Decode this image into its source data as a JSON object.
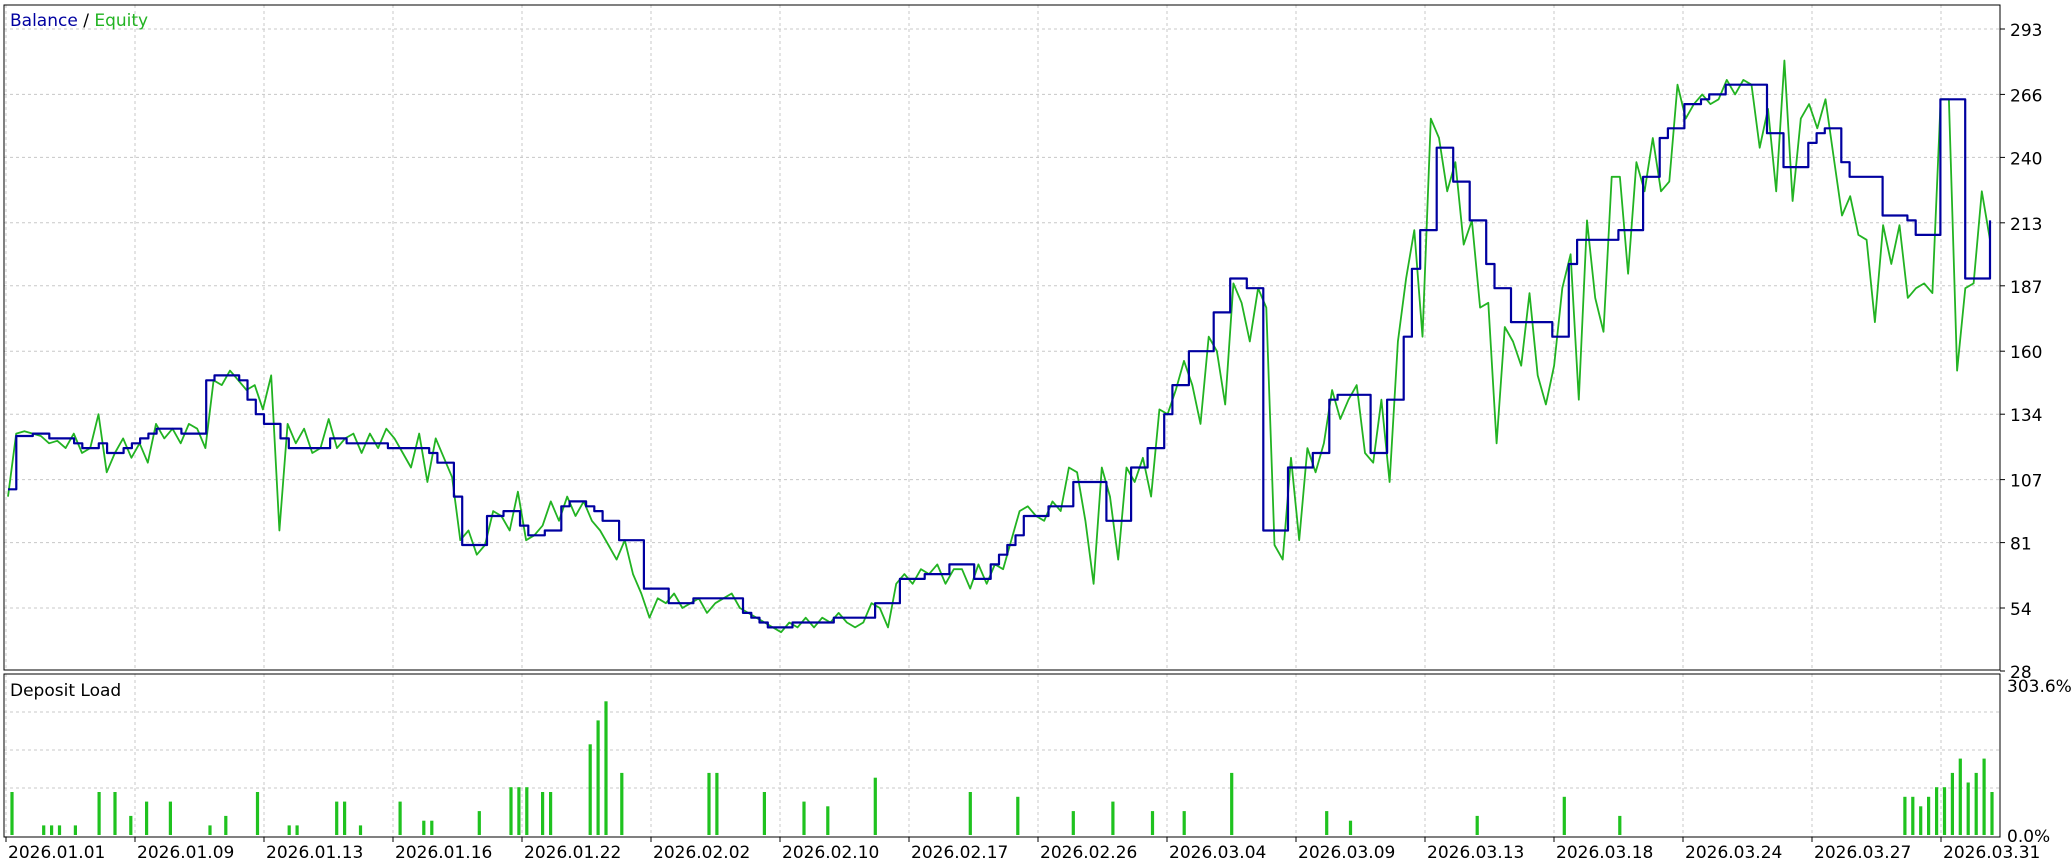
{
  "legend": {
    "balance_label": "Balance",
    "separator": " / ",
    "equity_label": "Equity"
  },
  "sub_title": "Deposit Load",
  "colors": {
    "balance": "#0000a0",
    "equity": "#22b322",
    "load_bars": "#1fc21f",
    "grid": "#c8c8c8",
    "frame": "#000000"
  },
  "chart_data": [
    {
      "type": "line",
      "title": "Balance / Equity",
      "ylim": [
        28,
        293
      ],
      "y_ticks": [
        "293",
        "266",
        "240",
        "213",
        "187",
        "160",
        "134",
        "107",
        "81",
        "54",
        "28"
      ],
      "grid": true,
      "legend_placement": "top-left",
      "series": [
        {
          "name": "Balance",
          "values": [
            103,
            125,
            125,
            126,
            126,
            124,
            124,
            124,
            122,
            120,
            120,
            122,
            118,
            118,
            120,
            122,
            124,
            126,
            128,
            128,
            128,
            126,
            126,
            126,
            148,
            150,
            150,
            150,
            148,
            140,
            134,
            130,
            130,
            124,
            120,
            120,
            120,
            120,
            120,
            124,
            124,
            122,
            122,
            122,
            122,
            122,
            120,
            120,
            120,
            120,
            120,
            118,
            114,
            114,
            100,
            80,
            80,
            80,
            92,
            92,
            94,
            94,
            88,
            84,
            84,
            86,
            86,
            96,
            98,
            98,
            96,
            94,
            90,
            90,
            82,
            82,
            82,
            62,
            62,
            62,
            56,
            56,
            56,
            58,
            58,
            58,
            58,
            58,
            58,
            52,
            50,
            48,
            46,
            46,
            46,
            48,
            48,
            48,
            48,
            48,
            50,
            50,
            50,
            50,
            50,
            56,
            56,
            56,
            66,
            66,
            66,
            68,
            68,
            68,
            72,
            72,
            72,
            66,
            66,
            72,
            76,
            80,
            84,
            92,
            92,
            92,
            96,
            96,
            96,
            106,
            106,
            106,
            106,
            90,
            90,
            90,
            112,
            112,
            120,
            120,
            134,
            146,
            146,
            160,
            160,
            160,
            176,
            176,
            190,
            190,
            186,
            186,
            86,
            86,
            86,
            112,
            112,
            112,
            118,
            118,
            140,
            142,
            142,
            142,
            142,
            118,
            118,
            140,
            140,
            166,
            194,
            210,
            210,
            244,
            244,
            230,
            230,
            214,
            214,
            196,
            186,
            186,
            172,
            172,
            172,
            172,
            172,
            166,
            166,
            196,
            206,
            206,
            206,
            206,
            206,
            210,
            210,
            210,
            232,
            232,
            248,
            252,
            252,
            262,
            262,
            264,
            266,
            266,
            270,
            270,
            270,
            270,
            270,
            250,
            250,
            236,
            236,
            236,
            246,
            250,
            252,
            252,
            238,
            232,
            232,
            232,
            232,
            216,
            216,
            216,
            214,
            208,
            208,
            208,
            264,
            264,
            264,
            190,
            190,
            190,
            214
          ]
        },
        {
          "name": "Equity",
          "values": [
            100,
            126,
            127,
            126,
            125,
            122,
            123,
            120,
            126,
            118,
            120,
            134,
            110,
            118,
            124,
            116,
            122,
            114,
            130,
            124,
            128,
            122,
            130,
            128,
            120,
            148,
            146,
            152,
            148,
            144,
            146,
            136,
            150,
            86,
            130,
            122,
            128,
            118,
            120,
            132,
            120,
            124,
            126,
            118,
            126,
            120,
            128,
            124,
            118,
            112,
            126,
            106,
            124,
            116,
            108,
            82,
            86,
            76,
            80,
            94,
            92,
            86,
            102,
            82,
            84,
            88,
            98,
            90,
            100,
            92,
            98,
            90,
            86,
            80,
            74,
            82,
            68,
            60,
            50,
            58,
            56,
            60,
            54,
            56,
            58,
            52,
            56,
            58,
            60,
            54,
            52,
            50,
            48,
            46,
            44,
            48,
            46,
            50,
            46,
            50,
            48,
            52,
            48,
            46,
            48,
            56,
            54,
            46,
            64,
            68,
            64,
            70,
            68,
            72,
            64,
            70,
            70,
            62,
            72,
            64,
            72,
            70,
            82,
            94,
            96,
            92,
            90,
            98,
            94,
            112,
            110,
            90,
            64,
            112,
            100,
            74,
            112,
            106,
            116,
            100,
            136,
            134,
            144,
            156,
            146,
            130,
            166,
            160,
            138,
            188,
            180,
            164,
            186,
            178,
            80,
            74,
            116,
            82,
            120,
            110,
            122,
            144,
            132,
            140,
            146,
            118,
            114,
            140,
            106,
            164,
            190,
            210,
            166,
            256,
            248,
            226,
            238,
            204,
            214,
            178,
            180,
            122,
            170,
            164,
            154,
            184,
            150,
            138,
            154,
            186,
            200,
            140,
            214,
            182,
            168,
            232,
            232,
            192,
            238,
            226,
            248,
            226,
            230,
            270,
            256,
            262,
            266,
            262,
            264,
            272,
            266,
            272,
            270,
            244,
            260,
            226,
            280,
            222,
            256,
            262,
            252,
            264,
            240,
            216,
            224,
            208,
            206,
            172,
            212,
            196,
            212,
            182,
            186,
            188,
            184,
            264,
            264,
            152,
            186,
            188,
            226,
            206
          ]
        }
      ]
    },
    {
      "type": "bar",
      "title": "Deposit Load",
      "ylim": [
        "0.0%",
        "303.6%"
      ],
      "x_tick_labels": [
        "2026.01.01",
        "2026.01.09",
        "2026.01.13",
        "2026.01.16",
        "2026.01.22",
        "2026.02.02",
        "2026.02.10",
        "2026.02.17",
        "2026.02.26",
        "2026.03.04",
        "2026.03.09",
        "2026.03.13",
        "2026.03.18",
        "2026.03.24",
        "2026.03.27",
        "2026.03.31"
      ],
      "values": [
        90,
        0,
        0,
        0,
        20,
        20,
        20,
        0,
        20,
        0,
        0,
        90,
        0,
        90,
        0,
        40,
        0,
        70,
        0,
        0,
        70,
        0,
        0,
        0,
        0,
        20,
        0,
        40,
        0,
        0,
        0,
        90,
        0,
        0,
        0,
        20,
        20,
        0,
        0,
        0,
        0,
        70,
        70,
        0,
        20,
        0,
        0,
        0,
        0,
        70,
        0,
        0,
        30,
        30,
        0,
        0,
        0,
        0,
        0,
        50,
        0,
        0,
        0,
        100,
        100,
        100,
        0,
        90,
        90,
        0,
        0,
        0,
        0,
        190,
        240,
        280,
        0,
        130,
        0,
        0,
        0,
        0,
        0,
        0,
        0,
        0,
        0,
        0,
        130,
        130,
        0,
        0,
        0,
        0,
        0,
        90,
        0,
        0,
        0,
        0,
        70,
        0,
        0,
        60,
        0,
        0,
        0,
        0,
        0,
        120,
        0,
        0,
        0,
        0,
        0,
        0,
        0,
        0,
        0,
        0,
        0,
        90,
        0,
        0,
        0,
        0,
        0,
        80,
        0,
        0,
        0,
        0,
        0,
        0,
        50,
        0,
        0,
        0,
        0,
        70,
        0,
        0,
        0,
        0,
        50,
        0,
        0,
        0,
        50,
        0,
        0,
        0,
        0,
        0,
        130,
        0,
        0,
        0,
        0,
        0,
        0,
        0,
        0,
        0,
        0,
        0,
        50,
        0,
        0,
        30,
        0,
        0,
        0,
        0,
        0,
        0,
        0,
        0,
        0,
        0,
        0,
        0,
        0,
        0,
        0,
        40,
        0,
        0,
        0,
        0,
        0,
        0,
        0,
        0,
        0,
        0,
        80,
        0,
        0,
        0,
        0,
        0,
        0,
        40,
        0,
        0,
        0,
        0,
        0,
        0,
        0,
        0,
        0,
        0,
        0,
        0,
        0,
        0,
        0,
        0,
        0,
        0,
        0,
        0,
        0,
        0,
        0,
        0,
        0,
        0,
        0,
        0,
        0,
        0,
        0,
        0,
        0,
        0,
        0,
        80,
        80,
        60,
        80,
        100,
        100,
        130,
        160,
        110,
        130,
        160,
        90
      ]
    }
  ]
}
